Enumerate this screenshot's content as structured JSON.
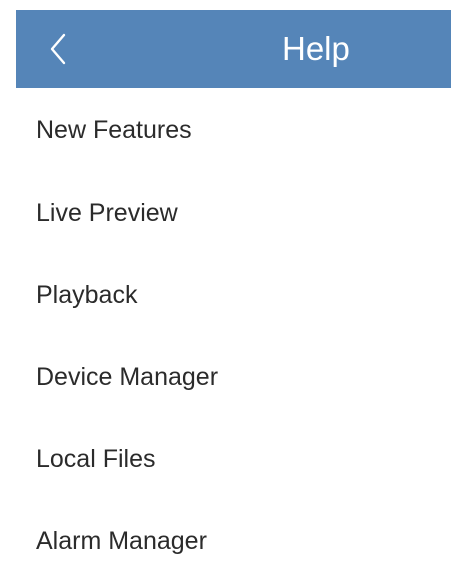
{
  "header": {
    "back_icon": "chevron-left-icon",
    "title": "Help",
    "background_color": "#5585b8"
  },
  "menu": {
    "items": [
      {
        "label": "New Features"
      },
      {
        "label": "Live Preview"
      },
      {
        "label": "Playback"
      },
      {
        "label": "Device Manager"
      },
      {
        "label": "Local Files"
      },
      {
        "label": "Alarm Manager"
      }
    ]
  }
}
